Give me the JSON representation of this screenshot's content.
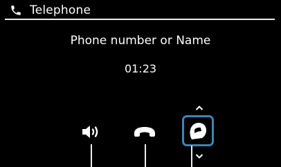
{
  "header": {
    "title": "Telephone",
    "icon": "phone-icon"
  },
  "call": {
    "prompt": "Phone number or Name",
    "duration": "01:23"
  },
  "controls": [
    {
      "name": "speaker-volume-button",
      "icon": "speaker-volume-icon"
    },
    {
      "name": "hang-up-button",
      "icon": "hang-up-icon"
    },
    {
      "name": "helmet-intercom-button",
      "icon": "helmet-icon",
      "selected": true
    }
  ],
  "colors": {
    "background": "#000000",
    "text": "#ffffff",
    "focus": "#3d86b8"
  }
}
